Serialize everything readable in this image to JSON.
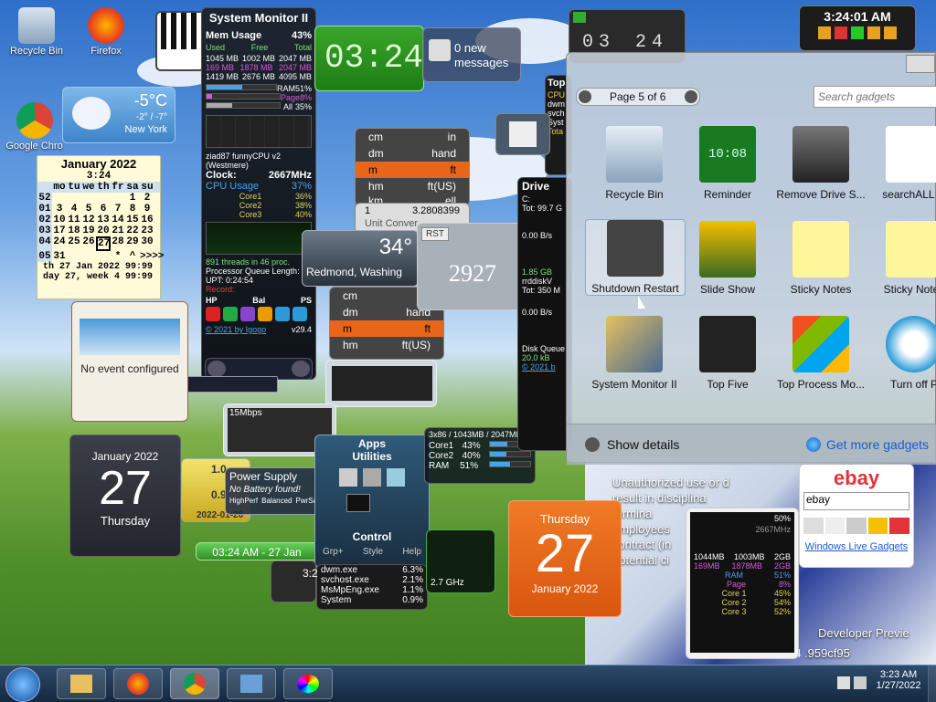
{
  "desktop_icons": {
    "recycle_bin": "Recycle Bin",
    "firefox": "Firefox",
    "chrome": "Google Chro"
  },
  "weather": {
    "temp": "-5°C",
    "range": "-2° / -7°",
    "city": "New York"
  },
  "calendar_small": {
    "month": "January 2022",
    "time": "3:24",
    "weekdays": [
      "mo",
      "tu",
      "we",
      "th",
      "fr",
      "sa",
      "su"
    ],
    "rows": [
      [
        "52",
        "",
        "",
        "",
        "",
        "",
        "1",
        "2"
      ],
      [
        "01",
        "3",
        "4",
        "5",
        "6",
        "7",
        "8",
        "9"
      ],
      [
        "02",
        "10",
        "11",
        "12",
        "13",
        "14",
        "15",
        "16"
      ],
      [
        "03",
        "17",
        "18",
        "19",
        "20",
        "21",
        "22",
        "23"
      ],
      [
        "04",
        "24",
        "25",
        "26",
        "27",
        "28",
        "29",
        "30"
      ],
      [
        "05",
        "31",
        "",
        "",
        "",
        "*",
        "^",
        ">>>>"
      ]
    ],
    "footer1": "th  27 Jan 2022    99:99",
    "footer2": "day 27, week 4    99:99"
  },
  "sysmon": {
    "title": "System Monitor II",
    "mem_label": "Mem Usage",
    "mem_pct": "43%",
    "col_used": "Used",
    "col_free": "Free",
    "col_total": "Total",
    "mem_rows": [
      [
        "1045 MB",
        "1002 MB",
        "2047 MB"
      ],
      [
        "169 MB",
        "1878 MB",
        "2047 MB"
      ],
      [
        "1419 MB",
        "2676 MB",
        "4095 MB"
      ]
    ],
    "ram": "RAM",
    "ram_pct": "51%",
    "page": "Page",
    "page_pct": "8%",
    "all": "All",
    "all_pct": "35%",
    "cpu_name": "ziad87 funnyCPU v2 (Westmere)",
    "clock_label": "Clock:",
    "clock_val": "2667MHz",
    "cpu_usage": "CPU Usage",
    "cpu_usage_pct": "37%",
    "cores": [
      [
        "Core1",
        "36%"
      ],
      [
        "Core2",
        "38%"
      ],
      [
        "Core3",
        "40%"
      ]
    ],
    "threads": "891 threads in 46 proc.",
    "pql": "Processor Queue Length: 0",
    "upt": "UPT: 0:24:54",
    "record": "Record:",
    "hp": "HP",
    "bal": "Bal",
    "ps": "PS",
    "credit": "© 2021 by Igogo",
    "version": "v29.4"
  },
  "digital_clock": {
    "time": "03:24"
  },
  "messages": {
    "count": "0 new",
    "label": "messages"
  },
  "flip_clock": {
    "digits": [
      "03",
      "24"
    ]
  },
  "clock_widget": {
    "time": "3:24:01 AM"
  },
  "converter": {
    "rows": [
      [
        "cm",
        "in"
      ],
      [
        "dm",
        "hand"
      ],
      [
        "m",
        "ft"
      ],
      [
        "hm",
        "ft(US)"
      ],
      [
        "km",
        "ell"
      ]
    ],
    "input": "1",
    "output": "3.2808399",
    "title": "Unit Conver"
  },
  "weather2": {
    "temp": "34°",
    "city": "Redmond, Washing"
  },
  "counter": {
    "rst": "RST",
    "value": "2927"
  },
  "search_bar": {
    "value": "C:"
  },
  "netmon": {
    "speed": "15Mbps"
  },
  "calendar_big": {
    "month": "January 2022",
    "day": "27",
    "weekday": "Thursday"
  },
  "power": {
    "title": "Power Supply",
    "status": "No Battery found!",
    "pct": "0%",
    "modes": [
      "HighPerf",
      "Balanced",
      "PwrSave"
    ]
  },
  "dates": {
    "d1": "1.0",
    "d2": "0.9",
    "date": "2022-01-26",
    "time_bar": "03:24 AM - 27 Jan"
  },
  "apps": {
    "apps": "Apps",
    "utilities": "Utilities",
    "control": "Control",
    "tabs": [
      "Grp+",
      "Style",
      "Help"
    ]
  },
  "processes": {
    "rows": [
      [
        "dwm.exe",
        "6.3%"
      ],
      [
        "svchost.exe",
        "2.1%"
      ],
      [
        "MsMpEng.exe",
        "1.1%"
      ],
      [
        "System",
        "0.9%"
      ]
    ],
    "clock_val": "3:2",
    "ghz": "2.7 GHz"
  },
  "meter": {
    "header": "3x86 / 1043MB / 2047MB",
    "rows": [
      [
        "Core1",
        "43%"
      ],
      [
        "Core2",
        "40%"
      ],
      [
        "RAM",
        "51%"
      ]
    ]
  },
  "orange_cal": {
    "weekday": "Thursday",
    "day": "27",
    "month": "January 2022"
  },
  "mini_mon": {
    "pct": "50%",
    "clock": "2667MHz",
    "mem": [
      [
        "1044MB",
        "1003MB",
        "2GB"
      ],
      [
        "169MB",
        "1878MB",
        "2GB"
      ]
    ],
    "rows": [
      [
        "RAM",
        "51%"
      ],
      [
        "Page",
        "8%"
      ],
      [
        "Core 1",
        "45%"
      ],
      [
        "Core 2",
        "54%"
      ],
      [
        "Core 3",
        "52%"
      ]
    ]
  },
  "drive": {
    "title": "Drive",
    "lines": [
      "C:",
      "Tot: 99.7 G",
      "0.00 B/s",
      "1.85 GB",
      "rrddiskV",
      "Tot: 350 M",
      "0.00 B/s",
      "Disk Queue",
      "20.0 kB"
    ],
    "credit": "© 2021 b"
  },
  "top_panel": {
    "title": "Top",
    "lines": [
      "CPU",
      "dwm",
      "svch",
      "Syst"
    ],
    "total": "Tota"
  },
  "ebay": {
    "logo": "ebay",
    "search": "ebay",
    "link": "Windows Live Gadgets"
  },
  "bg_text": {
    "lines": [
      "Unauthorized use or d",
      "result in disciplina",
      "termina",
      "employees",
      "contract (in",
      "potential ci"
    ],
    "dev": "Developer Previe",
    "hash": ".959cf95",
    "num": "64"
  },
  "gallery": {
    "page": "Page 5 of 6",
    "search_placeholder": "Search gadgets",
    "items": [
      "Recycle Bin",
      "Reminder",
      "Remove Drive S...",
      "searchALL G",
      "Shutdown Restart",
      "Slide Show",
      "Sticky Notes",
      "Sticky Notes",
      "System Monitor II",
      "Top Five",
      "Top Process Mo...",
      "Turn off P"
    ],
    "reminder_time": "10:08",
    "show_details": "Show details",
    "get_more": "Get more gadgets"
  },
  "no_event": {
    "text": "No event configured"
  },
  "taskbar": {
    "time": "3:23 AM",
    "date": "1/27/2022"
  },
  "colors": {
    "accent": "#46a3e8",
    "orange": "#e8661a",
    "green": "#3cae2c"
  }
}
